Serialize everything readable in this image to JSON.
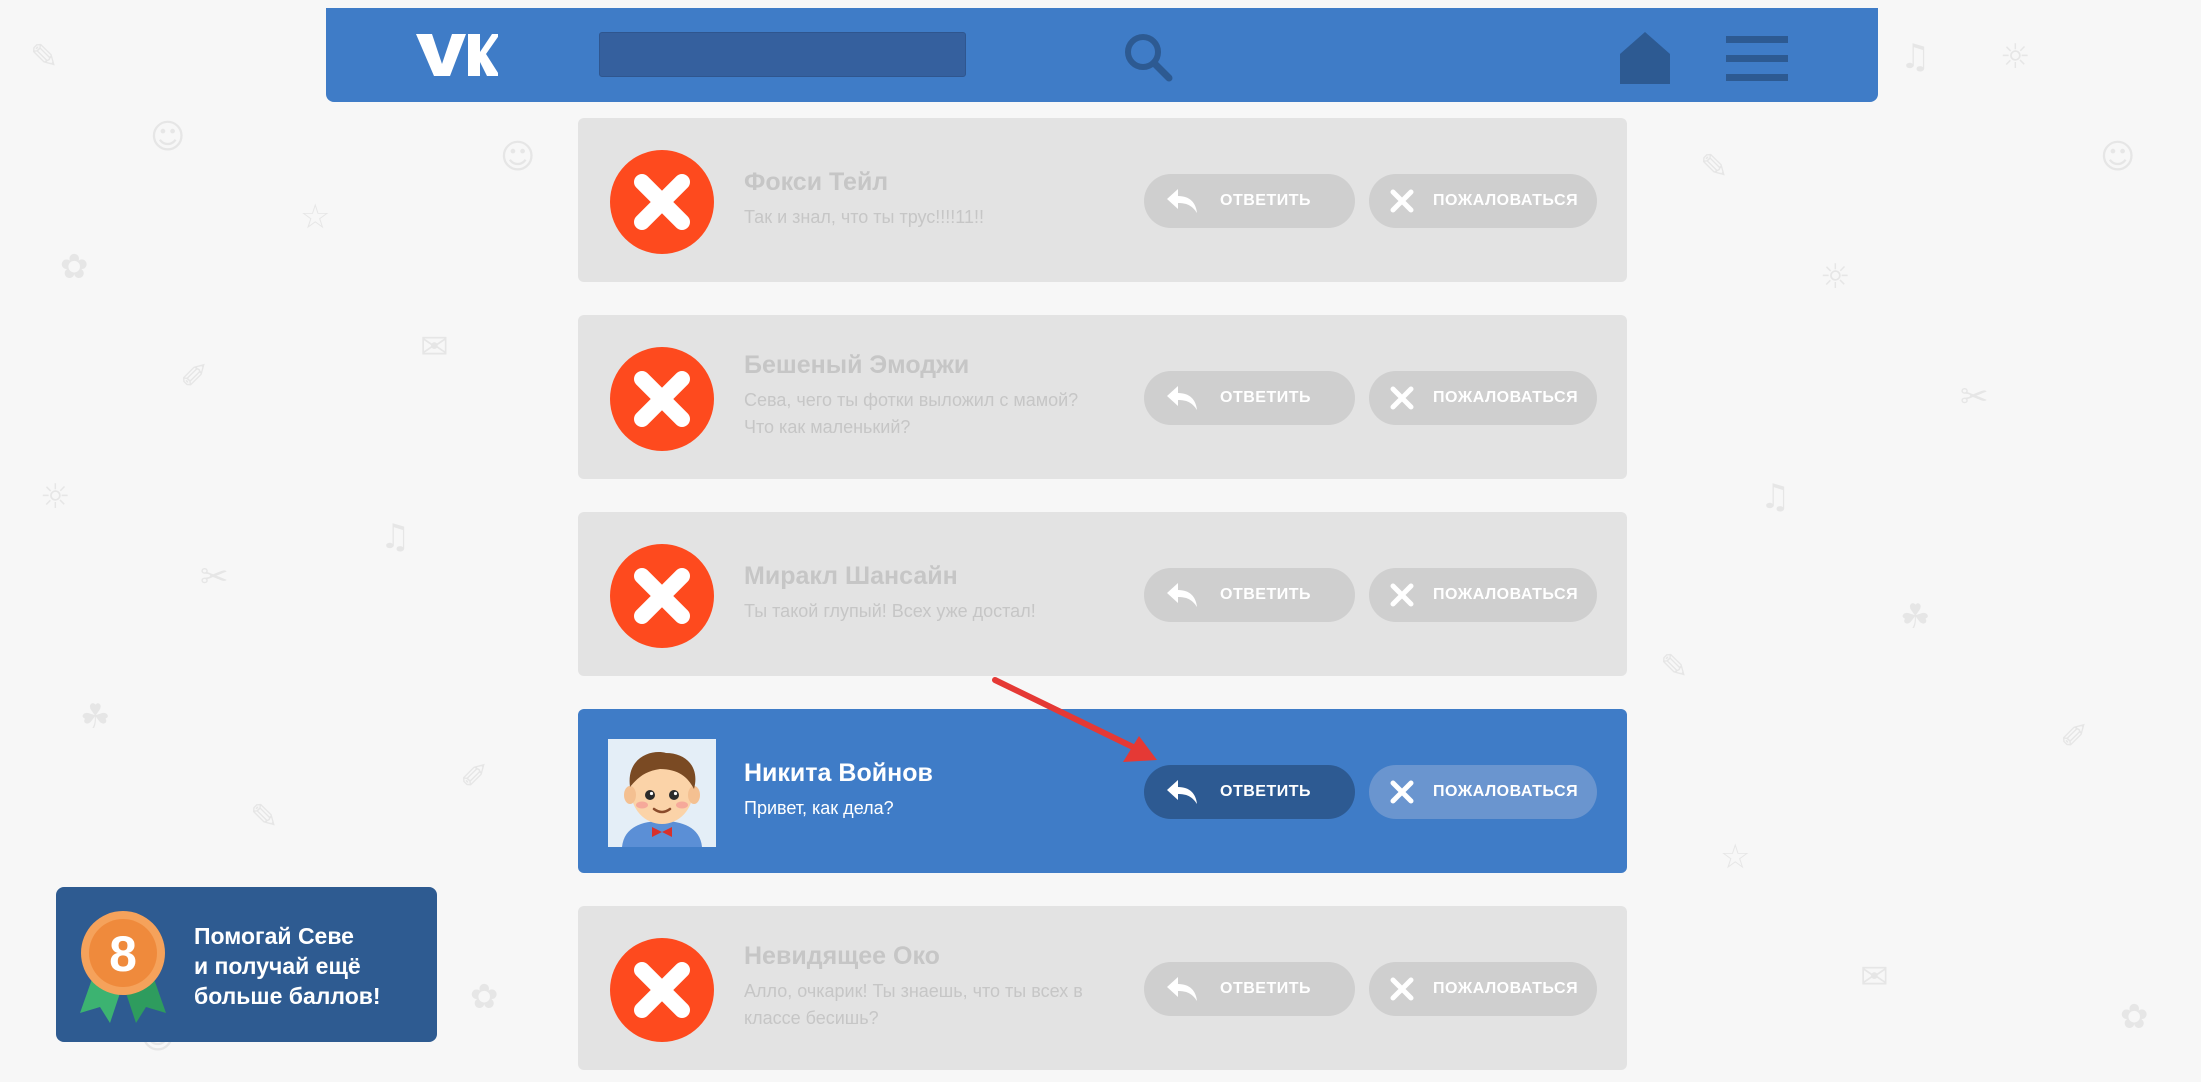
{
  "header": {
    "logo_text": "VK",
    "search": {
      "value": "",
      "placeholder": ""
    },
    "icons": [
      "search-icon",
      "home-icon",
      "menu-icon"
    ]
  },
  "messages": [
    {
      "name": "Фокси Тейл",
      "text": "Так и знал, что ты трус!!!!11!!",
      "reply_label": "ОТВЕТИТЬ",
      "report_label": "ПОЖАЛОВАТЬСЯ",
      "state": "blocked"
    },
    {
      "name": "Бешеный Эмоджи",
      "text": "Сева, чего ты фотки выложил с мамой? Что как маленький?",
      "reply_label": "ОТВЕТИТЬ",
      "report_label": "ПОЖАЛОВАТЬСЯ",
      "state": "blocked"
    },
    {
      "name": "Миракл Шансайн",
      "text": "Ты такой глупый! Всех уже достал!",
      "reply_label": "ОТВЕТИТЬ",
      "report_label": "ПОЖАЛОВАТЬСЯ",
      "state": "blocked"
    },
    {
      "name": "Никита Войнов",
      "text": "Привет, как дела?",
      "reply_label": "ОТВЕТИТЬ",
      "report_label": "ПОЖАЛОВАТЬСЯ",
      "state": "active"
    },
    {
      "name": "Невидящее Око",
      "text": "Алло, очкарик! Ты знаешь, что ты всех в классе бесишь?",
      "reply_label": "ОТВЕТИТЬ",
      "report_label": "ПОЖАЛОВАТЬСЯ",
      "state": "blocked"
    }
  ],
  "hint": {
    "badge_number": "8",
    "text": "Помогай Севе\nи получай ещё\nбольше баллов!"
  },
  "colors": {
    "brand_blue": "#3f7cc7",
    "card_gray": "#e3e3e3",
    "block_red": "#fe4a1e",
    "reply_dark": "#2d5a92",
    "pointer_red": "#e53935"
  }
}
